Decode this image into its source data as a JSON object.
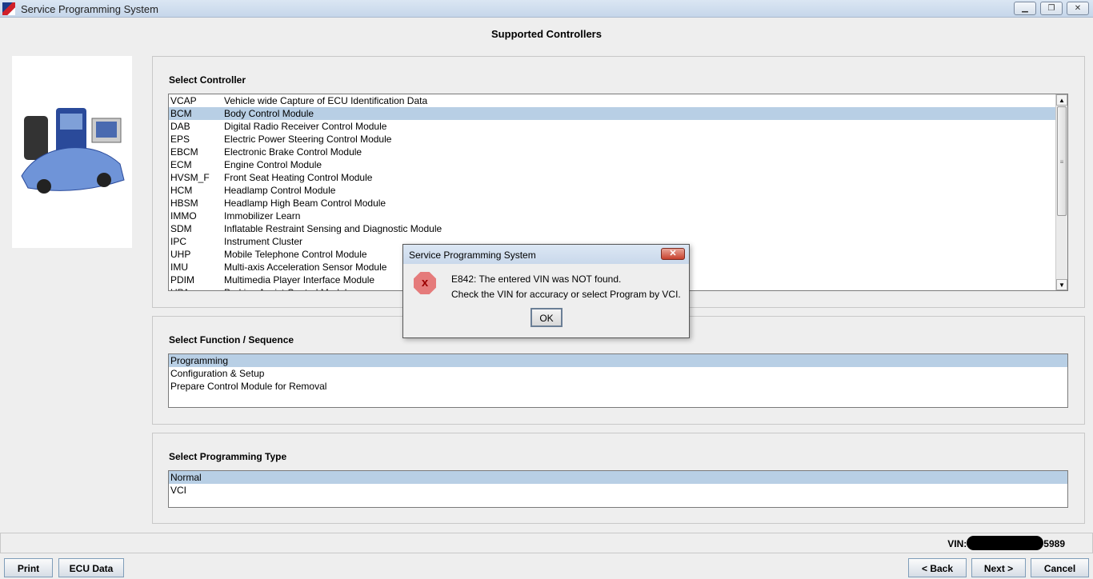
{
  "window": {
    "title": "Service Programming System",
    "controls": [
      "minimize",
      "restore",
      "close"
    ]
  },
  "heading": "Supported Controllers",
  "controllers": {
    "label": "Select Controller",
    "items": [
      {
        "code": "VCAP",
        "name": "Vehicle wide Capture of ECU Identification Data"
      },
      {
        "code": "BCM",
        "name": "Body Control Module",
        "selected": true
      },
      {
        "code": "DAB",
        "name": "Digital Radio Receiver Control Module"
      },
      {
        "code": "EPS",
        "name": "Electric Power Steering Control Module"
      },
      {
        "code": "EBCM",
        "name": "Electronic Brake Control Module"
      },
      {
        "code": "ECM",
        "name": "Engine Control Module"
      },
      {
        "code": "HVSM_F",
        "name": "Front Seat Heating Control Module"
      },
      {
        "code": "HCM",
        "name": "Headlamp Control Module"
      },
      {
        "code": "HBSM",
        "name": "Headlamp High Beam Control Module"
      },
      {
        "code": "IMMO",
        "name": "Immobilizer Learn"
      },
      {
        "code": "SDM",
        "name": "Inflatable Restraint Sensing and Diagnostic Module"
      },
      {
        "code": "IPC",
        "name": "Instrument Cluster"
      },
      {
        "code": "UHP",
        "name": "Mobile Telephone Control Module"
      },
      {
        "code": "IMU",
        "name": "Multi-axis Acceleration Sensor Module"
      },
      {
        "code": "PDIM",
        "name": "Multimedia Player Interface Module"
      },
      {
        "code": "UPA",
        "name": "Parking Assist Control Module"
      }
    ]
  },
  "functions": {
    "label": "Select Function / Sequence",
    "items": [
      "Programming",
      "Configuration & Setup",
      "Prepare Control Module for Removal"
    ],
    "selected": 0
  },
  "progtype": {
    "label": "Select Programming Type",
    "items": [
      "Normal",
      "VCI"
    ],
    "selected": 0
  },
  "vin": {
    "label": "VIN:",
    "suffix": "5989"
  },
  "buttons": {
    "print": "Print",
    "ecu": "ECU Data",
    "back": "< Back",
    "next": "Next >",
    "cancel": "Cancel"
  },
  "dialog": {
    "title": "Service Programming System",
    "line1": "E842: The entered VIN was NOT found.",
    "line2": "Check the VIN for accuracy or select Program by VCI.",
    "ok": "OK",
    "icon": "error-icon"
  }
}
